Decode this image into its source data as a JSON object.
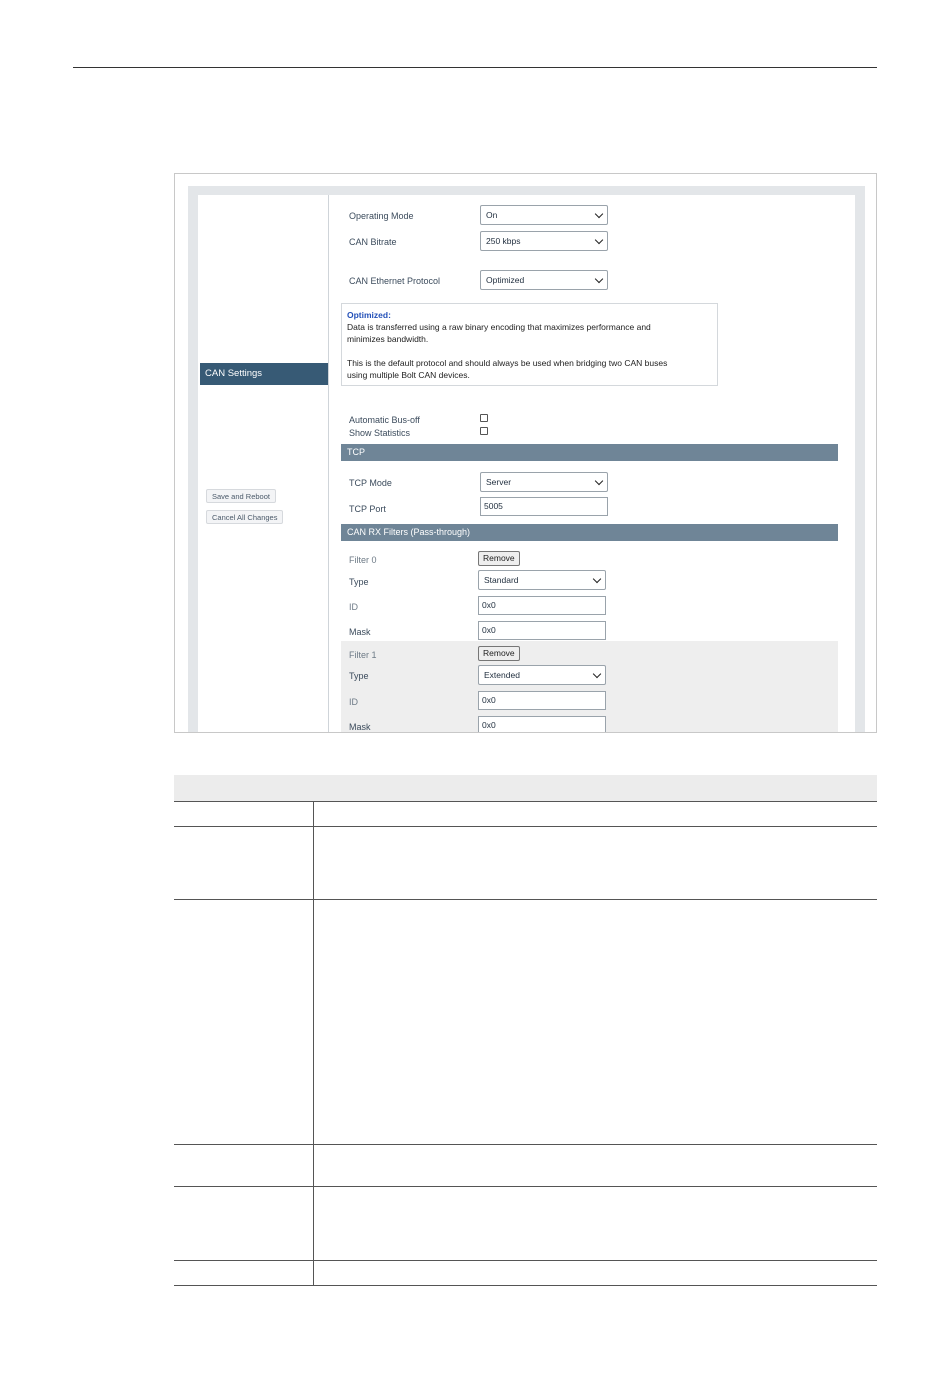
{
  "sidebar": {
    "active_item": "CAN Settings",
    "save_button": "Save and Reboot",
    "cancel_button": "Cancel All Changes"
  },
  "settings": {
    "operating_mode": {
      "label": "Operating Mode",
      "value": "On"
    },
    "can_bitrate": {
      "label": "CAN Bitrate",
      "value": "250 kbps"
    },
    "can_protocol": {
      "label": "CAN Ethernet Protocol",
      "value": "Optimized"
    },
    "info": {
      "title": "Optimized:",
      "line1": "Data is transferred using a raw binary encoding that maximizes performance and",
      "line2": "minimizes bandwidth.",
      "line3": "This is the default protocol and should always be used when bridging two CAN buses",
      "line4": "using multiple Bolt CAN devices."
    },
    "auto_bus_off": {
      "label": "Automatic Bus-off",
      "checked": false
    },
    "show_statistics": {
      "label": "Show Statistics",
      "checked": false
    }
  },
  "tcp": {
    "section_title": "TCP",
    "mode": {
      "label": "TCP Mode",
      "value": "Server"
    },
    "port": {
      "label": "TCP Port",
      "value": "5005"
    }
  },
  "filters": {
    "section_title": "CAN RX Filters (Pass-through)",
    "remove_label": "Remove",
    "type_label": "Type",
    "id_label": "ID",
    "mask_label": "Mask",
    "items": [
      {
        "name": "Filter 0",
        "type": "Standard",
        "id": "0x0",
        "mask": "0x0"
      },
      {
        "name": "Filter 1",
        "type": "Extended",
        "id": "0x0",
        "mask": "0x0"
      }
    ]
  }
}
